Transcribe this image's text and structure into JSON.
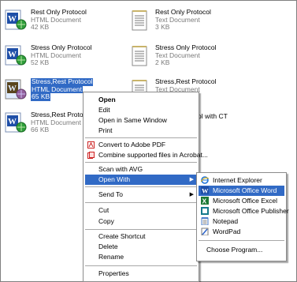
{
  "files": [
    {
      "name": "Rest Only Protocol",
      "type": "HTML Document",
      "size": "42 KB",
      "kind": "word"
    },
    {
      "name": "Rest Only Protocol",
      "type": "Text Document",
      "size": "3 KB",
      "kind": "text"
    },
    {
      "name": "Stress Only Protocol",
      "type": "HTML Document",
      "size": "52 KB",
      "kind": "word"
    },
    {
      "name": "Stress Only Protocol",
      "type": "Text Document",
      "size": "2 KB",
      "kind": "text"
    },
    {
      "name": "Stress,Rest Protocol",
      "type": "HTML Document",
      "size": "65 KB",
      "kind": "word"
    },
    {
      "name": "Stress,Rest Protocol",
      "type": "Text Document",
      "size": "",
      "kind": "text"
    },
    {
      "name": "Stress,Rest Proto",
      "type": "HTML Document",
      "size": "66 KB",
      "kind": "word"
    },
    {
      "name": "ol with CT",
      "type": "",
      "size": "",
      "kind": "text"
    }
  ],
  "context_menu": {
    "open": "Open",
    "edit": "Edit",
    "open_same_window": "Open in Same Window",
    "print": "Print",
    "convert_pdf": "Convert to Adobe PDF",
    "combine_acrobat": "Combine supported files in Acrobat...",
    "scan_avg": "Scan with AVG",
    "open_with": "Open With",
    "send_to": "Send To",
    "cut": "Cut",
    "copy": "Copy",
    "create_shortcut": "Create Shortcut",
    "delete": "Delete",
    "rename": "Rename",
    "properties": "Properties",
    "arrow": "▶"
  },
  "open_with_menu": {
    "ie": "Internet Explorer",
    "word": "Microsoft Office Word",
    "excel": "Microsoft Office Excel",
    "publisher": "Microsoft Office Publisher",
    "notepad": "Notepad",
    "wordpad": "WordPad",
    "choose": "Choose Program..."
  },
  "colors": {
    "selection": "#316ac5",
    "word_blue": "#1f4fa8",
    "green": "#2e9e3a"
  }
}
